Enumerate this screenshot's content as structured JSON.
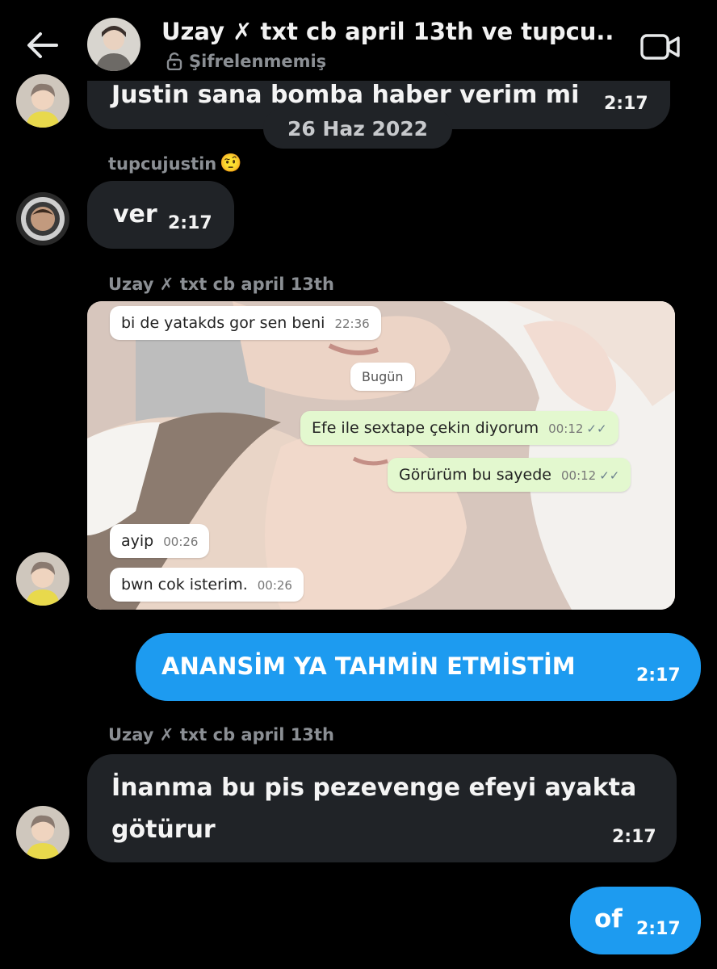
{
  "header": {
    "title": "Uzay ✗ txt cb april 13th ve tupcu...",
    "subtitle": "Şifrelenmemiş",
    "back_icon": "arrow-left-icon",
    "video_icon": "video-camera-icon",
    "lock_icon": "unlock-icon"
  },
  "messages": {
    "m1": {
      "text": "Justin sana bomba haber verim mi",
      "time": "2:17"
    },
    "date_divider": "26 Haz 2022",
    "m2": {
      "sender": "tupcujustin",
      "sender_emoji": "🤨",
      "text": "ver",
      "time": "2:17"
    },
    "m3": {
      "sender": "Uzay ✗ txt cb april 13th"
    },
    "m4": {
      "text": "ANANSİM YA TAHMİN ETMİSTİM",
      "time": "2:17"
    },
    "m5": {
      "sender": "Uzay ✗ txt cb april 13th",
      "text_line1": "İnanma bu pis pezevenge efeyi ayakta",
      "text_line2": "götürur",
      "time": "2:17"
    },
    "m6": {
      "text": "of",
      "time": "2:17"
    }
  },
  "screenshot_chat": [
    {
      "text": "bi de yatakds gor sen beni",
      "time": "22:36"
    },
    {
      "text": "Bugün"
    },
    {
      "text": "Efe ile sextape çekin diyorum",
      "time": "00:12"
    },
    {
      "text": "Görürüm bu sayede",
      "time": "00:12"
    },
    {
      "text": "ayip",
      "time": "00:26"
    },
    {
      "text": "bwn cok isterim.",
      "time": "00:26"
    }
  ],
  "colors": {
    "background": "#000000",
    "bubble_dark": "#202327",
    "bubble_blue": "#1d9bf0",
    "muted": "#8b8f94"
  }
}
